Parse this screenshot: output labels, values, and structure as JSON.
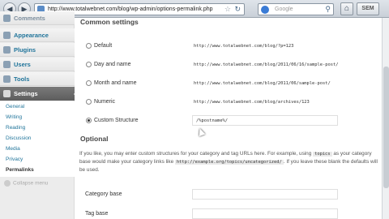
{
  "browser": {
    "url": "http://www.totalwebnet.com/blog/wp-admin/options-permalink.php",
    "search_placeholder": "Google",
    "toolbar_button": "SEM"
  },
  "sidebar": {
    "partial_item": "Comments",
    "items": [
      "Appearance",
      "Plugins",
      "Users",
      "Tools"
    ],
    "current": "Settings",
    "submenu": [
      "General",
      "Writing",
      "Reading",
      "Discussion",
      "Media",
      "Privacy",
      "Permalinks"
    ],
    "submenu_current": "Permalinks",
    "collapse": "Collapse menu"
  },
  "common": {
    "heading": "Common settings",
    "options": [
      {
        "label": "Default",
        "sample": "http://www.totalwebnet.com/blog/?p=123",
        "checked": false
      },
      {
        "label": "Day and name",
        "sample": "http://www.totalwebnet.com/blog/2011/06/16/sample-post/",
        "checked": false
      },
      {
        "label": "Month and name",
        "sample": "http://www.totalwebnet.com/blog/2011/06/sample-post/",
        "checked": false
      },
      {
        "label": "Numeric",
        "sample": "http://www.totalwebnet.com/blog/archives/123",
        "checked": false
      },
      {
        "label": "Custom Structure",
        "sample": "/%postname%/",
        "checked": true
      }
    ]
  },
  "optional": {
    "heading": "Optional",
    "desc_1": "If you like, you may enter custom structures for your category and tag URLs here. For example, using",
    "code_1": "topics",
    "desc_2": "as your category base would make your category links like",
    "code_2": "http://example.org/topics/uncategorized/",
    "desc_3": ". If you leave these blank the defaults will be used.",
    "category_base_label": "Category base",
    "tag_base_label": "Tag base"
  }
}
